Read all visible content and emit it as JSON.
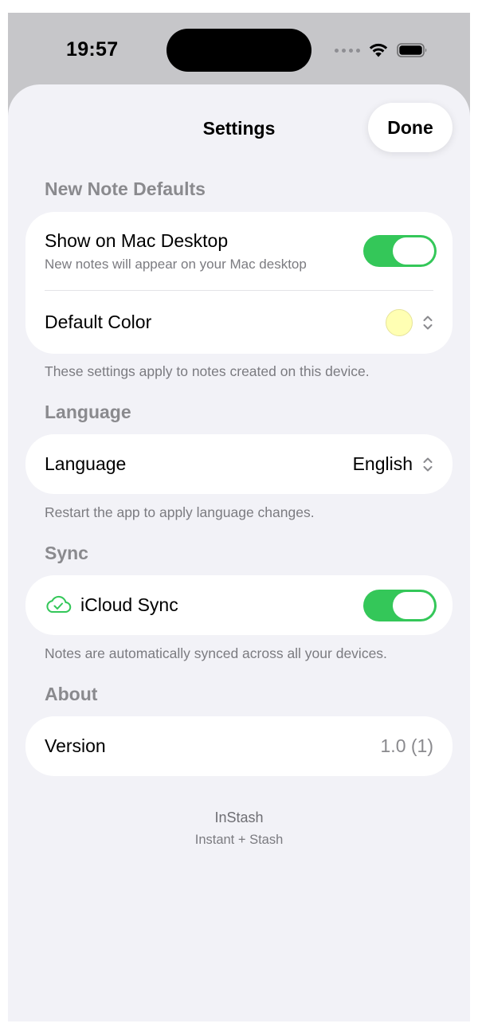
{
  "status_bar": {
    "time": "19:57",
    "icons": [
      "signal-dots-icon",
      "wifi-icon",
      "battery-icon"
    ]
  },
  "nav": {
    "title": "Settings",
    "done_label": "Done"
  },
  "sections": {
    "new_note_defaults": {
      "header": "New Note Defaults",
      "show_on_mac": {
        "label": "Show on Mac Desktop",
        "subtitle": "New notes will appear on your Mac desktop",
        "enabled": true
      },
      "default_color": {
        "label": "Default Color",
        "swatch_color": "#ffffb3"
      },
      "footer": "These settings apply to notes created on this device."
    },
    "language": {
      "header": "Language",
      "row_label": "Language",
      "value": "English",
      "footer": "Restart the app to apply language changes."
    },
    "sync": {
      "header": "Sync",
      "icloud": {
        "label": "iCloud Sync",
        "enabled": true,
        "icon": "cloud-check-icon"
      },
      "footer": "Notes are automatically synced across all your devices."
    },
    "about": {
      "header": "About",
      "version_label": "Version",
      "version_value": "1.0 (1)"
    }
  },
  "app_info": {
    "name": "InStash",
    "tagline": "Instant + Stash"
  },
  "colors": {
    "accent_green": "#34c759",
    "background": "#f2f2f7",
    "secondary_text": "#8a8a8e"
  }
}
